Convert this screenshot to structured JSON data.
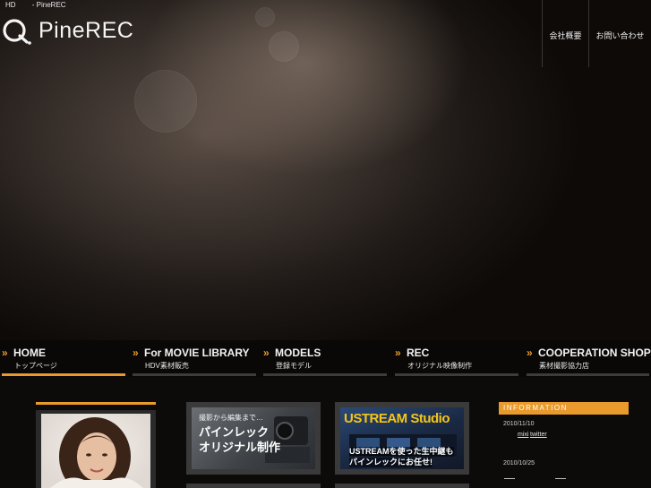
{
  "header": {
    "tagline": "HD   - PineREC",
    "logo_text": "PineREC",
    "links": [
      "会社概要",
      "お問い合わせ"
    ]
  },
  "nav": [
    {
      "en": "HOME",
      "ja": "トップページ",
      "active": true
    },
    {
      "en": "For MOVIE LIBRARY",
      "ja": "HDV素材販売",
      "active": false
    },
    {
      "en": "MODELS",
      "ja": "登録モデル",
      "active": false
    },
    {
      "en": "REC",
      "ja": "オリジナル映像制作",
      "active": false
    },
    {
      "en": "COOPERATION SHOP",
      "ja": "素材撮影協力店",
      "active": false
    }
  ],
  "banners": {
    "original": {
      "small": "撮影から編集まで…",
      "line1": "パインレック",
      "line2": "オリジナル制作"
    },
    "ustream": {
      "title": "USTREAM Studio",
      "line1": "USTREAMを使った生中継も",
      "line2": "パインレックにお任せ!"
    }
  },
  "information": {
    "title": "INFORMATION",
    "entries": [
      {
        "date": "2010/11/10",
        "links": [
          "mixi",
          "twitter"
        ]
      },
      {
        "date": "2010/10/25"
      }
    ]
  },
  "colors": {
    "accent": "#e89a2c",
    "background": "#0a0807"
  }
}
